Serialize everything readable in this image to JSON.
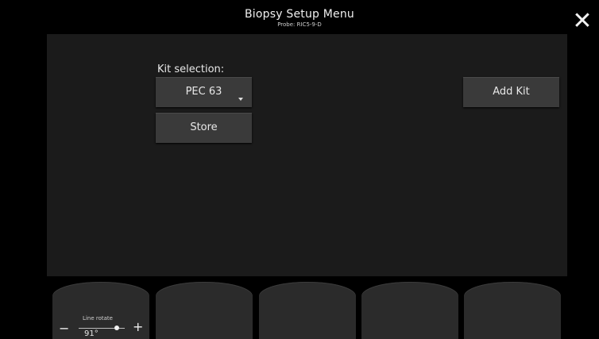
{
  "header": {
    "title": "Biopsy Setup Menu",
    "probe": "Probe: RIC5-9-D"
  },
  "close_icon": "close-icon",
  "kit": {
    "label": "Kit selection:",
    "selected": "PEC 63",
    "store_label": "Store",
    "add_label": "Add Kit"
  },
  "softkeys": {
    "line_rotate": {
      "label": "Line rotate",
      "value": "91°",
      "minus": "−",
      "plus": "+"
    }
  }
}
